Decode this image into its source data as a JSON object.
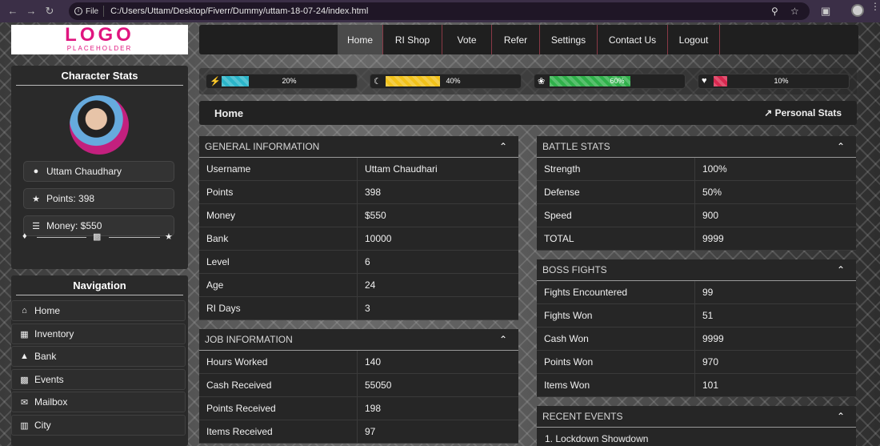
{
  "browser": {
    "file_label": "File",
    "url": "C:/Users/Uttam/Desktop/Fiverr/Dummy/uttam-18-07-24/index.html"
  },
  "logo": {
    "line1": "LOGO",
    "line2": "PLACEHOLDER"
  },
  "character_stats": {
    "title": "Character Stats",
    "name": "Uttam Chaudhary",
    "points": "Points: 398",
    "money": "Money: $550"
  },
  "navigation": {
    "title": "Navigation",
    "items": [
      {
        "label": "Home",
        "icon": "home-icon"
      },
      {
        "label": "Inventory",
        "icon": "box-icon"
      },
      {
        "label": "Bank",
        "icon": "bank-icon"
      },
      {
        "label": "Events",
        "icon": "calendar-icon"
      },
      {
        "label": "Mailbox",
        "icon": "mail-icon"
      },
      {
        "label": "City",
        "icon": "city-icon"
      }
    ]
  },
  "topnav": [
    "Home",
    "RI Shop",
    "Vote",
    "Refer",
    "Settings",
    "Contact Us",
    "Logout"
  ],
  "bars": [
    {
      "icon": "bolt-icon",
      "pct": "20%",
      "value": 0.2,
      "color": "#2bb5c9"
    },
    {
      "icon": "moon-icon",
      "pct": "40%",
      "value": 0.4,
      "color": "#f2c21a"
    },
    {
      "icon": "brain-icon",
      "pct": "60%",
      "value": 0.6,
      "color": "#2fb04a"
    },
    {
      "icon": "heart-icon",
      "pct": "10%",
      "value": 0.1,
      "color": "#d8284f"
    }
  ],
  "home": {
    "title": "Home",
    "personal_stats": "Personal Stats"
  },
  "general": {
    "title": "GENERAL INFORMATION",
    "rows": [
      [
        "Username",
        "Uttam Chaudhari"
      ],
      [
        "Points",
        "398"
      ],
      [
        "Money",
        "$550"
      ],
      [
        "Bank",
        "10000"
      ],
      [
        "Level",
        "6"
      ],
      [
        "Age",
        "24"
      ],
      [
        "RI Days",
        "3"
      ]
    ]
  },
  "job": {
    "title": "JOB INFORMATION",
    "rows": [
      [
        "Hours Worked",
        "140"
      ],
      [
        "Cash Received",
        "55050"
      ],
      [
        "Points Received",
        "198"
      ],
      [
        "Items Received",
        "97"
      ]
    ]
  },
  "battle": {
    "title": "BATTLE STATS",
    "rows": [
      [
        "Strength",
        "100%"
      ],
      [
        "Defense",
        "50%"
      ],
      [
        "Speed",
        "900"
      ],
      [
        "TOTAL",
        "9999"
      ]
    ]
  },
  "boss": {
    "title": "BOSS FIGHTS",
    "rows": [
      [
        "Fights Encountered",
        "99"
      ],
      [
        "Fights Won",
        "51"
      ],
      [
        "Cash Won",
        "9999"
      ],
      [
        "Points Won",
        "970"
      ],
      [
        "Items Won",
        "101"
      ]
    ]
  },
  "recent": {
    "title": "RECENT EVENTS",
    "first": "1. Lockdown Showdown"
  }
}
